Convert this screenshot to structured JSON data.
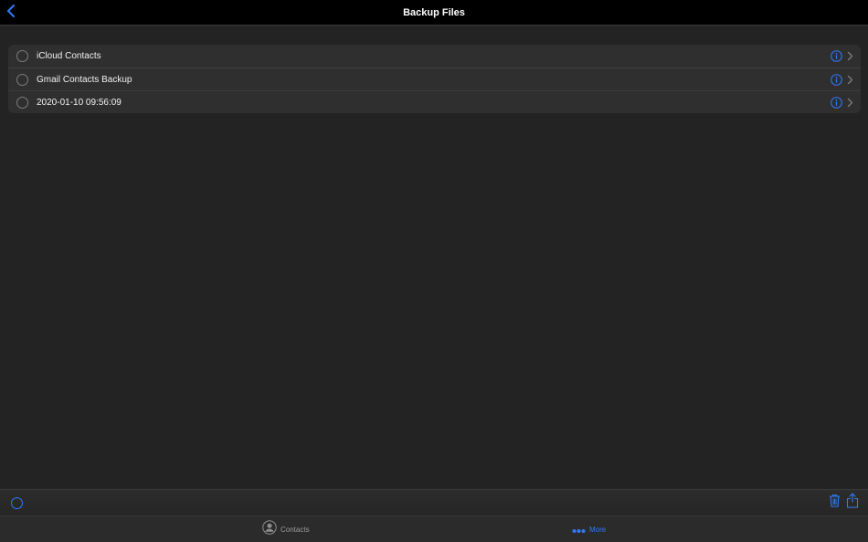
{
  "navbar": {
    "title": "Backup Files",
    "back_icon": "chevron-left-icon"
  },
  "backups": [
    {
      "label": "iCloud Contacts"
    },
    {
      "label": "Gmail Contacts Backup"
    },
    {
      "label": "2020-01-10 09:56:09"
    }
  ],
  "toolbar": {
    "select_icon": "circle-icon",
    "trash_icon": "trash-icon",
    "share_icon": "share-icon"
  },
  "tabbar": {
    "contacts_label": "Contacts",
    "more_label": "More",
    "selected": "More"
  },
  "colors": {
    "accent": "#2f7cf6",
    "background": "#232323",
    "navbar": "#000000",
    "list_background": "#2f2f2f"
  }
}
